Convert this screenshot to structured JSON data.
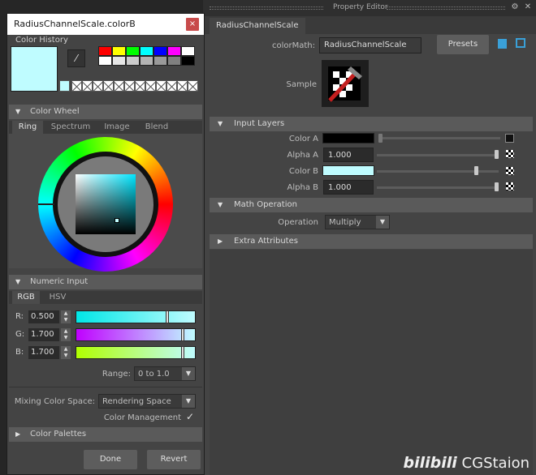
{
  "property_editor": {
    "title": "Property Editor",
    "tab": "RadiusChannelScale",
    "color_math_label": "colorMath:",
    "color_math_value": "RadiusChannelScale",
    "presets_label": "Presets",
    "sample_label": "Sample",
    "input_layers": {
      "header": "Input Layers",
      "color_a_label": "Color A",
      "color_a_swatch": "#000000",
      "alpha_a_label": "Alpha A",
      "alpha_a_value": "1.000",
      "alpha_a_level": 1.0,
      "color_b_label": "Color B",
      "color_b_swatch": "#bffcff",
      "color_b_level": 0.85,
      "alpha_b_label": "Alpha B",
      "alpha_b_value": "1.000",
      "alpha_b_level": 1.0
    },
    "math_operation": {
      "header": "Math Operation",
      "operation_label": "Operation",
      "operation_value": "Multiply"
    },
    "extra_attributes_header": "Extra Attributes"
  },
  "color_editor": {
    "title": "RadiusChannelScale.colorB",
    "close_glyph": "×",
    "history_label": "Color History",
    "current_color": "#bffcff",
    "palette_row1": [
      "#ff0000",
      "#ffff00",
      "#00ff00",
      "#00ffff",
      "#0000ff",
      "#ff00ff",
      "#ffffff"
    ],
    "palette_row2": [
      "#ffffff",
      "#e6e6e6",
      "#cccccc",
      "#b3b3b3",
      "#999999",
      "#808080",
      "#000000"
    ],
    "color_wheel_header": "Color Wheel",
    "wheel_tabs": [
      "Ring",
      "Spectrum",
      "Image",
      "Blend"
    ],
    "numeric_header": "Numeric Input",
    "numeric_tabs": [
      "RGB",
      "HSV"
    ],
    "channels": [
      {
        "label": "R:",
        "value": "0.500",
        "level": 0.75
      },
      {
        "label": "G:",
        "value": "1.700",
        "level": 0.88
      },
      {
        "label": "B:",
        "value": "1.700",
        "level": 0.88
      }
    ],
    "range_label": "Range:",
    "range_value": "0 to 1.0",
    "mixing_label": "Mixing Color Space:",
    "mixing_value": "Rendering Space",
    "color_management_label": "Color Management",
    "color_management_check": "✓",
    "palettes_header": "Color Palettes",
    "done_label": "Done",
    "revert_label": "Revert"
  },
  "watermark": {
    "brand": "bilibili",
    "channel": "CGStaion"
  }
}
